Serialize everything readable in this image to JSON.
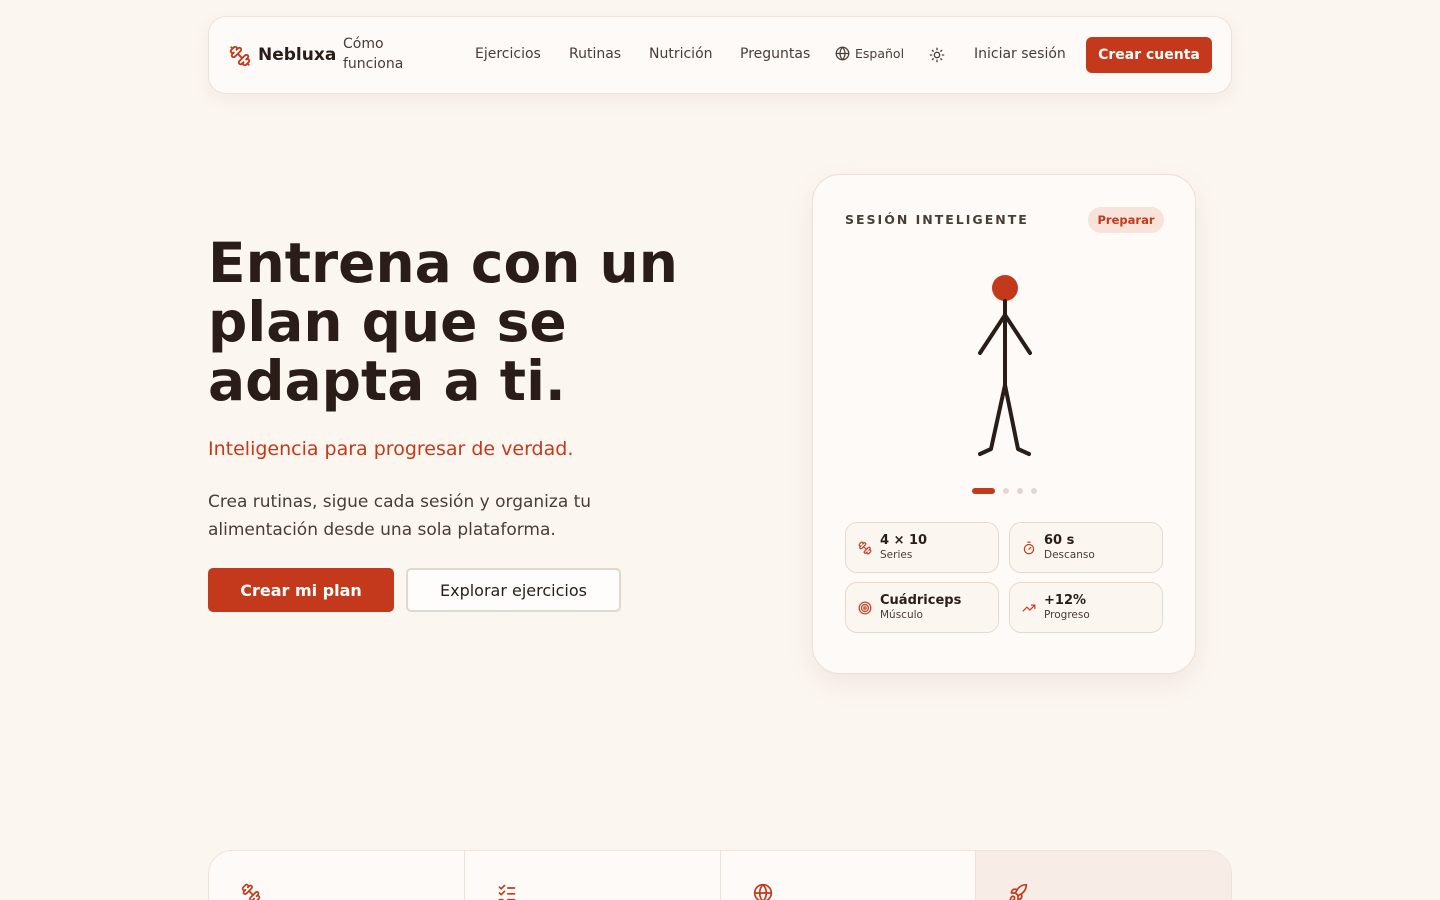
{
  "colors": {
    "accent": "#c4391b",
    "background": "#fcf6f1",
    "text": "#2a1d18"
  },
  "nav": {
    "brand": "Nebluxa",
    "how_it_works": "Cómo funciona",
    "links": [
      "Ejercicios",
      "Rutinas",
      "Nutrición",
      "Preguntas"
    ],
    "language": "Español",
    "login": "Iniciar sesión",
    "signup": "Crear cuenta"
  },
  "hero": {
    "title": "Entrena con un plan que se adapta a ti.",
    "subtitle": "Inteligencia para progresar de verdad.",
    "description": "Crea rutinas, sigue cada sesión y organiza tu alimentación desde una sola plataforma.",
    "primary_cta": "Crear mi plan",
    "secondary_cta": "Explorar ejercicios"
  },
  "session_card": {
    "label": "SESIÓN INTELIGENTE",
    "badge": "Preparar",
    "carousel_active": 1,
    "carousel_total": 4,
    "stats": [
      {
        "icon": "dumbbell-icon",
        "value": "4 × 10",
        "caption": "Series"
      },
      {
        "icon": "timer-icon",
        "value": "60 s",
        "caption": "Descanso"
      },
      {
        "icon": "target-icon",
        "value": "Cuádriceps",
        "caption": "Músculo"
      },
      {
        "icon": "trending-up-icon",
        "value": "+12%",
        "caption": "Progreso"
      }
    ]
  },
  "features": {
    "icons": [
      "dumbbell-icon",
      "checklist-icon",
      "globe-icon",
      "rocket-icon"
    ]
  }
}
